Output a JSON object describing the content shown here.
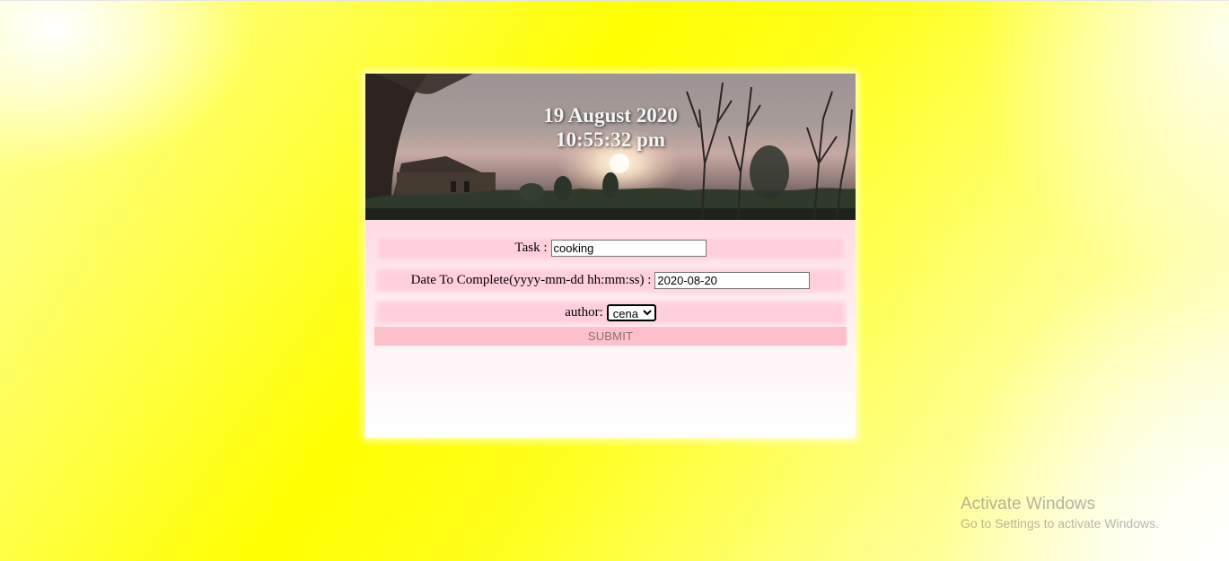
{
  "banner": {
    "date": "19 August 2020",
    "time": "10:55:32 pm"
  },
  "form": {
    "task_label": "Task :",
    "task_value": "cooking",
    "date_label": "Date To Complete(yyyy-mm-dd hh:mm:ss) :",
    "date_value": "2020-08-20",
    "author_label": "author:",
    "author_selected": "cena",
    "submit_label": "SUBMIT"
  },
  "watermark": {
    "title": "Activate Windows",
    "subtitle": "Go to Settings to activate Windows."
  },
  "colors": {
    "page_background": "#ffff00",
    "card_background": "#ffd7e0",
    "field_row": "#ffd0db",
    "submit_background": "#ffc0cb",
    "banner_text": "#f6f6f6"
  }
}
